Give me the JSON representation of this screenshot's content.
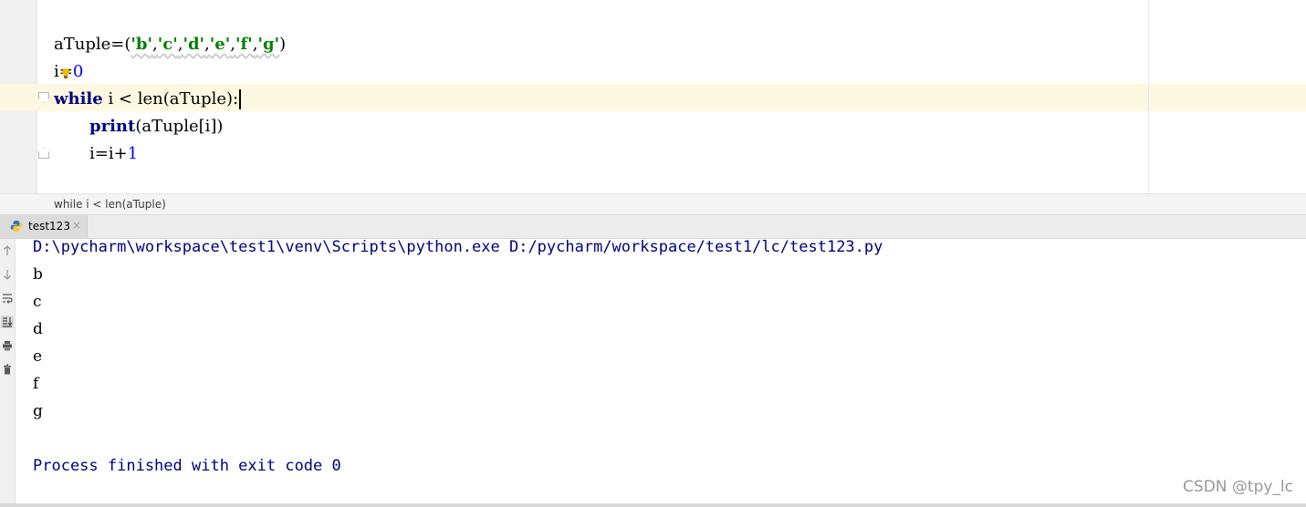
{
  "editor": {
    "line1_var": "aTuple",
    "line1_eq": "=(",
    "line1_items": [
      "'b'",
      "'c'",
      "'d'",
      "'e'",
      "'f'",
      "'g'"
    ],
    "line1_close": ")",
    "line2_var_a": "i",
    "line2_eq": "=",
    "line2_val": "0",
    "line3_kw": "while",
    "line3_rest": " i < len(aTuple):",
    "line4_fn": "print",
    "line4_rest": "(aTuple[i])",
    "line5_a": "i=i+",
    "line5_num": "1"
  },
  "breadcrumb": {
    "text": "while i < len(aTuple)"
  },
  "run_tab": {
    "label": "test123",
    "close": "×"
  },
  "console": {
    "command": "D:\\pycharm\\workspace\\test1\\venv\\Scripts\\python.exe D:/pycharm/workspace/test1/lc/test123.py",
    "outputs": [
      "b",
      "c",
      "d",
      "e",
      "f",
      "g"
    ],
    "exit": "Process finished with exit code 0"
  },
  "watermark": "CSDN @tpy_lc",
  "colors": {
    "keyword": "#000080",
    "string": "#008000",
    "number": "#0000ff",
    "caret_row": "#fdf8e1"
  }
}
